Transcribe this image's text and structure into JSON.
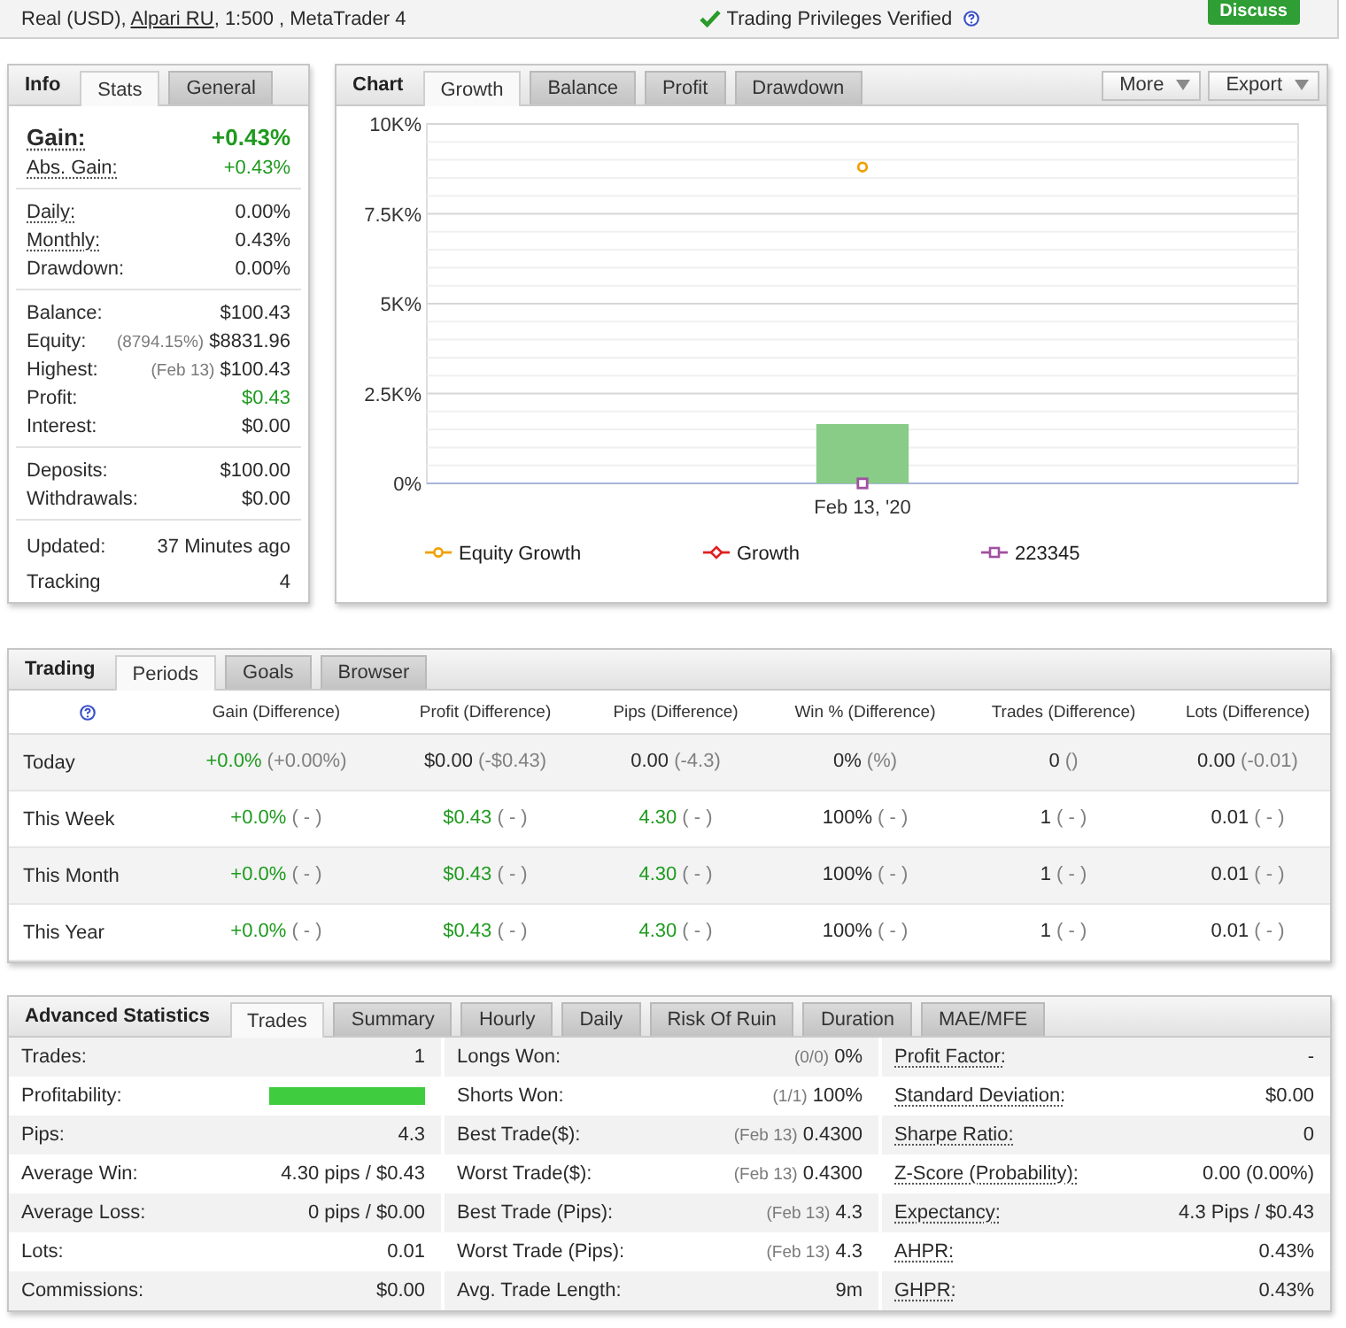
{
  "account_bar": {
    "account": "Real (USD), ",
    "broker": "Alpari RU",
    "details": ", 1:500 , MetaTrader 4",
    "verified": "Trading Privileges Verified",
    "discuss_button": "Discuss"
  },
  "info": {
    "title": "Info",
    "tabs": [
      {
        "label": "Stats",
        "selected": true
      },
      {
        "label": "General",
        "selected": false
      }
    ],
    "groups": [
      {
        "rows": [
          {
            "kind": "headline",
            "label": "Gain:",
            "value": "+0.43%",
            "positive": true,
            "tooltip": true
          },
          {
            "kind": "row",
            "label": "Abs. Gain:",
            "value": "+0.43%",
            "positive": true,
            "tooltip": true
          }
        ]
      },
      {
        "rows": [
          {
            "kind": "row",
            "label": "Daily:",
            "value": "0.00%",
            "positive": false,
            "tooltip": true
          },
          {
            "kind": "row",
            "label": "Monthly:",
            "value": "0.43%",
            "positive": false,
            "tooltip": true
          },
          {
            "kind": "row",
            "label": "Drawdown:",
            "value": "0.00%",
            "positive": false,
            "tooltip": false
          }
        ]
      },
      {
        "rows": [
          {
            "kind": "row",
            "label": "Balance:",
            "value": "$100.43",
            "positive": false,
            "tooltip": false
          },
          {
            "kind": "row",
            "label": "Equity:",
            "note": "(8794.15%)",
            "value": "$8831.96",
            "positive": false,
            "tooltip": false
          },
          {
            "kind": "row",
            "label": "Highest:",
            "note": "(Feb 13)",
            "value": "$100.43",
            "positive": false,
            "tooltip": false
          },
          {
            "kind": "row",
            "label": "Profit:",
            "value": "$0.43",
            "positive": true,
            "tooltip": false
          },
          {
            "kind": "row",
            "label": "Interest:",
            "value": "$0.00",
            "positive": false,
            "tooltip": false
          }
        ]
      },
      {
        "rows": [
          {
            "kind": "row",
            "label": "Deposits:",
            "value": "$100.00",
            "positive": false,
            "tooltip": false
          },
          {
            "kind": "row",
            "label": "Withdrawals:",
            "value": "$0.00",
            "positive": false,
            "tooltip": false
          }
        ]
      },
      {
        "rows": [
          {
            "kind": "row",
            "label": "Updated:",
            "value": "37 Minutes ago",
            "positive": false,
            "tooltip": false
          },
          {
            "kind": "row",
            "label": "Tracking",
            "value": "4",
            "positive": false,
            "tooltip": false
          }
        ]
      }
    ]
  },
  "chart": {
    "title": "Chart",
    "tabs": [
      {
        "label": "Growth",
        "selected": true
      },
      {
        "label": "Balance",
        "selected": false
      },
      {
        "label": "Profit",
        "selected": false
      },
      {
        "label": "Drawdown",
        "selected": false
      }
    ],
    "buttons": [
      "More",
      "Export"
    ],
    "chart_data": {
      "type": "line",
      "grid": true,
      "legend": "bottom",
      "categories": [
        "Feb 13, '20"
      ],
      "ylim": [
        0,
        10000
      ],
      "yticks": [
        {
          "value": 0,
          "label": "0%"
        },
        {
          "value": 2500,
          "label": "2.5K%"
        },
        {
          "value": 5000,
          "label": "5K%"
        },
        {
          "value": 7500,
          "label": "7.5K%"
        },
        {
          "value": 10000,
          "label": "10K%"
        }
      ],
      "series": [
        {
          "name": "Equity Growth",
          "color": "#f0a000",
          "marker": "circle",
          "values": [
            8800
          ]
        },
        {
          "name": "Growth",
          "color": "#e02020",
          "marker": "diamond",
          "values": [
            null
          ]
        },
        {
          "name": "223345",
          "color": "#a050a0",
          "marker": "square",
          "values": [
            0
          ]
        },
        {
          "color": "#88cc88",
          "type": "bar",
          "values": [
            1650
          ]
        }
      ]
    }
  },
  "trading": {
    "title": "Trading",
    "tabs": [
      {
        "label": "Periods",
        "selected": true
      },
      {
        "label": "Goals",
        "selected": false
      },
      {
        "label": "Browser",
        "selected": false
      }
    ],
    "columns": [
      "Gain (Difference)",
      "Profit (Difference)",
      "Pips (Difference)",
      "Win % (Difference)",
      "Trades (Difference)",
      "Lots (Difference)"
    ],
    "rows": [
      {
        "period": "Today",
        "cells": [
          {
            "value": "+0.0%",
            "diff": "(+0.00%)",
            "positive": true
          },
          {
            "value": "$0.00",
            "diff": "(-$0.43)",
            "positive": false
          },
          {
            "value": "0.00",
            "diff": "(-4.3)",
            "positive": false
          },
          {
            "value": "0%",
            "diff": "(%)",
            "positive": false
          },
          {
            "value": "0",
            "diff": "()",
            "positive": false
          },
          {
            "value": "0.00",
            "diff": "(-0.01)",
            "positive": false
          }
        ]
      },
      {
        "period": "This Week",
        "cells": [
          {
            "value": "+0.0%",
            "diff": "( - )",
            "positive": true
          },
          {
            "value": "$0.43",
            "diff": "( - )",
            "positive": true
          },
          {
            "value": "4.30",
            "diff": "( - )",
            "positive": true
          },
          {
            "value": "100%",
            "diff": "( - )",
            "positive": false
          },
          {
            "value": "1",
            "diff": "( - )",
            "positive": false
          },
          {
            "value": "0.01",
            "diff": "( - )",
            "positive": false
          }
        ]
      },
      {
        "period": "This Month",
        "cells": [
          {
            "value": "+0.0%",
            "diff": "( - )",
            "positive": true
          },
          {
            "value": "$0.43",
            "diff": "( - )",
            "positive": true
          },
          {
            "value": "4.30",
            "diff": "( - )",
            "positive": true
          },
          {
            "value": "100%",
            "diff": "( - )",
            "positive": false
          },
          {
            "value": "1",
            "diff": "( - )",
            "positive": false
          },
          {
            "value": "0.01",
            "diff": "( - )",
            "positive": false
          }
        ]
      },
      {
        "period": "This Year",
        "cells": [
          {
            "value": "+0.0%",
            "diff": "( - )",
            "positive": true
          },
          {
            "value": "$0.43",
            "diff": "( - )",
            "positive": true
          },
          {
            "value": "4.30",
            "diff": "( - )",
            "positive": true
          },
          {
            "value": "100%",
            "diff": "( - )",
            "positive": false
          },
          {
            "value": "1",
            "diff": "( - )",
            "positive": false
          },
          {
            "value": "0.01",
            "diff": "( - )",
            "positive": false
          }
        ]
      }
    ]
  },
  "advanced": {
    "title": "Advanced Statistics",
    "tabs": [
      {
        "label": "Trades",
        "selected": true
      },
      {
        "label": "Summary",
        "selected": false
      },
      {
        "label": "Hourly",
        "selected": false
      },
      {
        "label": "Daily",
        "selected": false
      },
      {
        "label": "Risk Of Ruin",
        "selected": false
      },
      {
        "label": "Duration",
        "selected": false
      },
      {
        "label": "MAE/MFE",
        "selected": false
      }
    ],
    "columns": [
      {
        "rows": [
          {
            "kind": "text",
            "label": "Trades:",
            "value": "1",
            "tooltip": false
          },
          {
            "kind": "bar",
            "label": "Profitability:",
            "level": 1,
            "tooltip": false
          },
          {
            "kind": "text",
            "label": "Pips:",
            "value": "4.3",
            "tooltip": false
          },
          {
            "kind": "text",
            "label": "Average Win:",
            "value": "4.30 pips / $0.43",
            "tooltip": false
          },
          {
            "kind": "text",
            "label": "Average Loss:",
            "value": "0 pips / $0.00",
            "tooltip": false
          },
          {
            "kind": "text",
            "label": "Lots:",
            "value": "0.01",
            "tooltip": false
          },
          {
            "kind": "text",
            "label": "Commissions:",
            "value": "$0.00",
            "tooltip": false
          }
        ]
      },
      {
        "rows": [
          {
            "kind": "text",
            "label": "Longs Won:",
            "note": "(0/0)",
            "value": "0%",
            "tooltip": false
          },
          {
            "kind": "text",
            "label": "Shorts Won:",
            "note": "(1/1)",
            "value": "100%",
            "tooltip": false
          },
          {
            "kind": "text",
            "label": "Best Trade($):",
            "note": "(Feb 13)",
            "value": "0.4300",
            "tooltip": false
          },
          {
            "kind": "text",
            "label": "Worst Trade($):",
            "note": "(Feb 13)",
            "value": "0.4300",
            "tooltip": false
          },
          {
            "kind": "text",
            "label": "Best Trade (Pips):",
            "note": "(Feb 13)",
            "value": "4.3",
            "tooltip": false
          },
          {
            "kind": "text",
            "label": "Worst Trade (Pips):",
            "note": "(Feb 13)",
            "value": "4.3",
            "tooltip": false
          },
          {
            "kind": "text",
            "label": "Avg. Trade Length:",
            "value": "9m",
            "tooltip": false
          }
        ]
      },
      {
        "rows": [
          {
            "kind": "text",
            "label": "Profit Factor:",
            "value": "-",
            "tooltip": true
          },
          {
            "kind": "text",
            "label": "Standard Deviation:",
            "value": "$0.00",
            "tooltip": true
          },
          {
            "kind": "text",
            "label": "Sharpe Ratio:",
            "value": "0",
            "tooltip": true
          },
          {
            "kind": "text",
            "label": "Z-Score (Probability):",
            "value": "0.00 (0.00%)",
            "tooltip": true
          },
          {
            "kind": "text",
            "label": "Expectancy:",
            "value": "4.3 Pips / $0.43",
            "tooltip": true
          },
          {
            "kind": "text",
            "label": "AHPR:",
            "value": "0.43%",
            "tooltip": true
          },
          {
            "kind": "text",
            "label": "GHPR:",
            "value": "0.43%",
            "tooltip": true
          }
        ]
      }
    ]
  }
}
